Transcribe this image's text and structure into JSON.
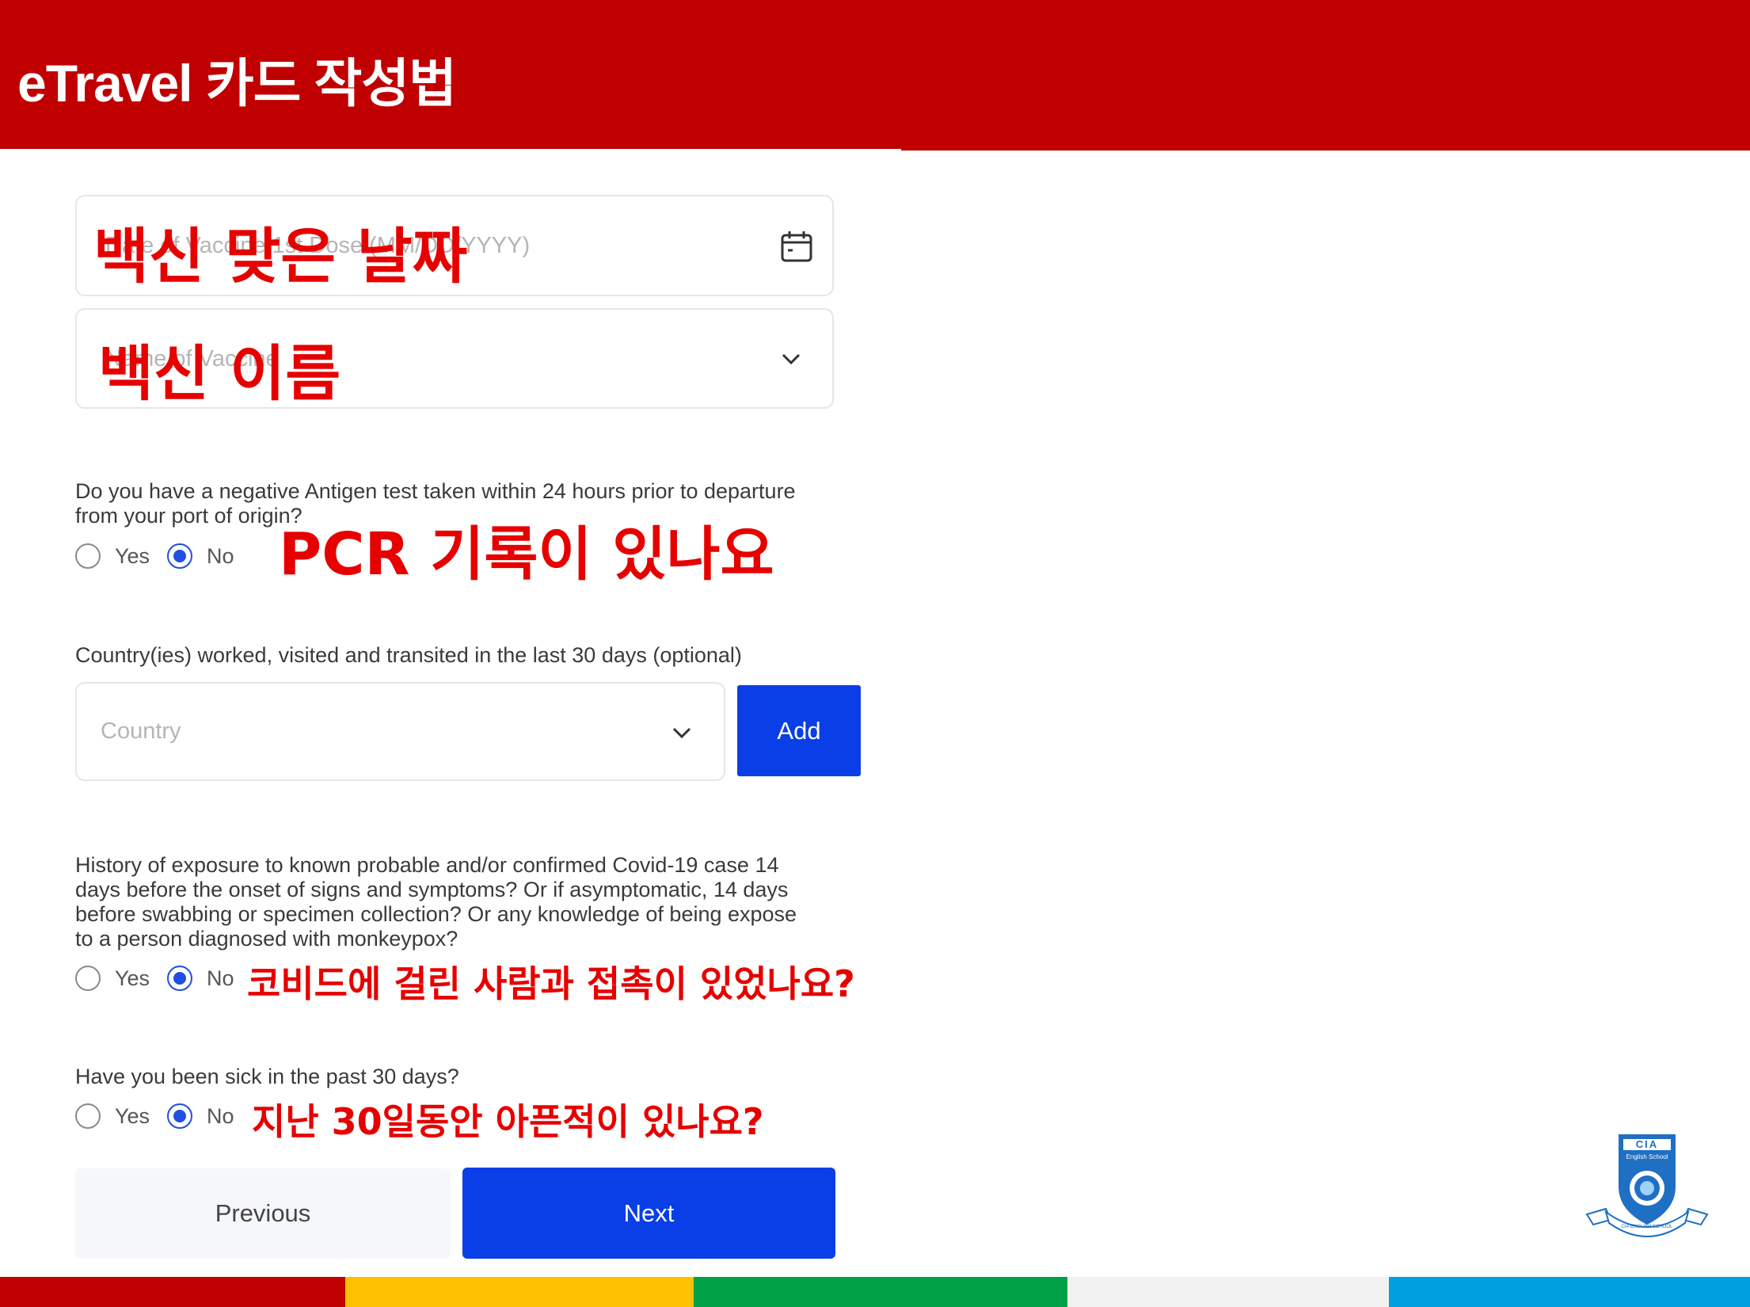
{
  "header": {
    "title": "eTravel 카드 작성법"
  },
  "vaccine_date": {
    "placeholder": "Date of Vaccine 1st Dose (MM/DD/YYYY)",
    "overlay": "백신 맞은 날짜"
  },
  "vaccine_name": {
    "placeholder": "Name of Vaccine",
    "overlay": "백신 이름"
  },
  "antigen": {
    "question_line1": "Do you have a negative Antigen test taken within 24 hours prior to departure",
    "question_line2": "from your port of origin?",
    "yes": "Yes",
    "no": "No",
    "selected": "No",
    "overlay": "PCR 기록이 있나요"
  },
  "countries": {
    "label": "Country(ies) worked, visited and transited in the last 30 days (optional)",
    "placeholder": "Country",
    "add_label": "Add"
  },
  "exposure": {
    "question_lines": [
      "History of exposure to known probable and/or confirmed Covid-19 case 14",
      "days before the onset of signs and symptoms? Or if asymptomatic, 14 days",
      "before swabbing or specimen collection? Or any knowledge of being expose",
      "to a person diagnosed with monkeypox?"
    ],
    "yes": "Yes",
    "no": "No",
    "selected": "No",
    "overlay": "코비드에 걸린 사람과 접촉이 있었나요?"
  },
  "sick": {
    "question": "Have you been sick in the past 30 days?",
    "yes": "Yes",
    "no": "No",
    "selected": "No",
    "overlay": "지난 30일동안 아픈적이 있나요?"
  },
  "nav": {
    "previous": "Previous",
    "next": "Next"
  },
  "logo": {
    "name": "CIA",
    "subtitle": "English School",
    "ribbon": "CIA ENGLISH SCHOOL"
  },
  "colors": {
    "header_red": "#c00000",
    "primary_blue": "#0a3ee6",
    "stripe": [
      "#c00000",
      "#ffc000",
      "#00a046",
      "#f2f2f2",
      "#00a0e0"
    ]
  }
}
